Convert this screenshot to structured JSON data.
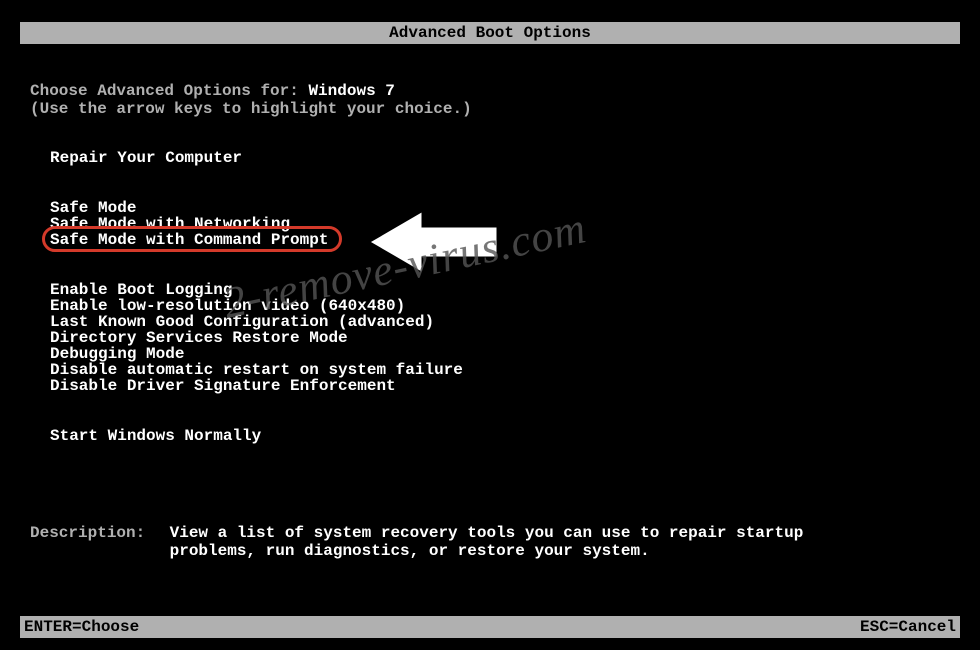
{
  "title": "Advanced Boot Options",
  "prompt_prefix": "Choose Advanced Options for: ",
  "os_name": "Windows 7",
  "instructions": "(Use the arrow keys to highlight your choice.)",
  "menu": {
    "group1": [
      "Repair Your Computer"
    ],
    "group2": [
      "Safe Mode",
      "Safe Mode with Networking",
      "Safe Mode with Command Prompt"
    ],
    "group3": [
      "Enable Boot Logging",
      "Enable low-resolution video (640x480)",
      "Last Known Good Configuration (advanced)",
      "Directory Services Restore Mode",
      "Debugging Mode",
      "Disable automatic restart on system failure",
      "Disable Driver Signature Enforcement"
    ],
    "group4": [
      "Start Windows Normally"
    ]
  },
  "highlighted_item": "Safe Mode with Command Prompt",
  "description": {
    "label": "Description:",
    "text": "View a list of system recovery tools you can use to repair startup problems, run diagnostics, or restore your system."
  },
  "footer": {
    "enter": "ENTER=Choose",
    "esc": "ESC=Cancel"
  },
  "watermark_text": "2-remove-virus.com",
  "annotation": {
    "box_color": "#d43a2a",
    "arrow_color": "#ffffff"
  }
}
